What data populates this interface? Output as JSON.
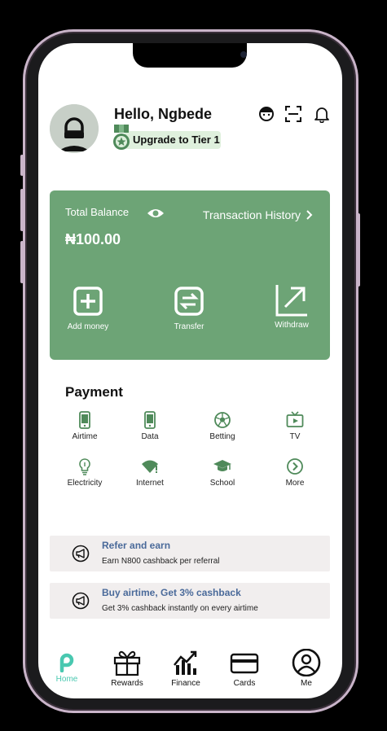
{
  "header": {
    "greeting": "Hello, Ngbede",
    "tier_label": "Upgrade to Tier  1",
    "icons": [
      "support-icon",
      "scan-icon",
      "bell-icon"
    ]
  },
  "balance_card": {
    "label": "Total Balance",
    "history_label": "Transaction History",
    "amount": "₦100.00",
    "actions": [
      {
        "label": "Add money",
        "icon": "plus-square-icon"
      },
      {
        "label": "Transfer",
        "icon": "transfer-icon"
      },
      {
        "label": "Withdraw",
        "icon": "withdraw-arrow-icon"
      }
    ],
    "color": "#6da476"
  },
  "payment": {
    "title": "Payment",
    "items": [
      {
        "label": "Airtime",
        "icon": "phone-icon"
      },
      {
        "label": "Data",
        "icon": "mobile-data-icon"
      },
      {
        "label": "Betting",
        "icon": "football-icon"
      },
      {
        "label": "TV",
        "icon": "tv-icon"
      },
      {
        "label": "Electricity",
        "icon": "bulb-icon"
      },
      {
        "label": "Internet",
        "icon": "wifi-icon"
      },
      {
        "label": "School",
        "icon": "graduation-cap-icon"
      },
      {
        "label": "More",
        "icon": "chevron-circle-icon"
      }
    ]
  },
  "promos": [
    {
      "title": "Refer and earn",
      "subtitle": "Earn N800 cashback per referral",
      "icon": "megaphone-icon"
    },
    {
      "title": "Buy airtime, Get 3% cashback",
      "subtitle": "Get 3% cashback instantly on every airtime",
      "icon": "megaphone-icon"
    }
  ],
  "nav": [
    {
      "label": "Home",
      "icon": "home-logo-icon",
      "active": true
    },
    {
      "label": "Rewards",
      "icon": "gift-icon"
    },
    {
      "label": "Finance",
      "icon": "chart-icon"
    },
    {
      "label": "Cards",
      "icon": "card-icon"
    },
    {
      "label": "Me",
      "icon": "user-icon"
    }
  ],
  "colors": {
    "accent": "#6da476",
    "icon_green": "#4f8a5a",
    "nav_active": "#49c8b0",
    "promo_title": "#4a6a9a"
  }
}
